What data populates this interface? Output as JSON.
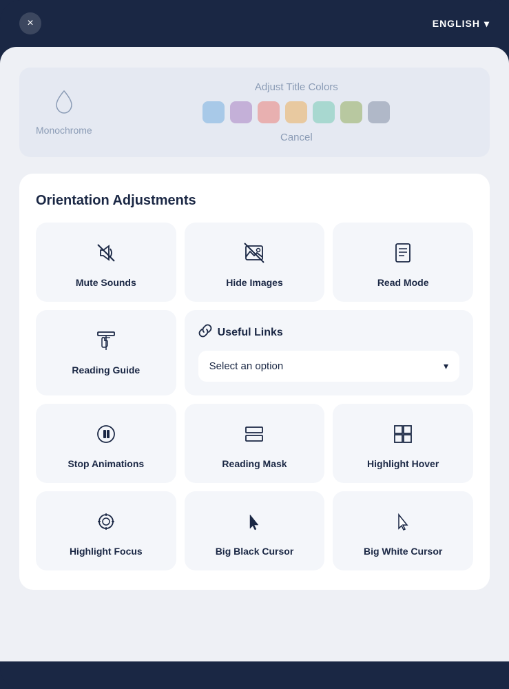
{
  "topBar": {
    "closeLabel": "×",
    "language": "ENGLISH",
    "chevron": "▾"
  },
  "colorSection": {
    "monochromeLabel": "Monochrome",
    "adjustTitle": "Adjust Title Colors",
    "cancelLabel": "Cancel",
    "swatches": [
      {
        "color": "#a8c9e8",
        "name": "blue"
      },
      {
        "color": "#c4b0d8",
        "name": "purple"
      },
      {
        "color": "#e8b0b0",
        "name": "pink"
      },
      {
        "color": "#e8c9a0",
        "name": "orange"
      },
      {
        "color": "#a8d8d0",
        "name": "teal"
      },
      {
        "color": "#b8c8a0",
        "name": "green"
      },
      {
        "color": "#b0b8c8",
        "name": "gray"
      }
    ]
  },
  "orientationSection": {
    "title": "Orientation Adjustments",
    "cards": [
      {
        "id": "mute-sounds",
        "label": "Mute Sounds",
        "icon": "mute"
      },
      {
        "id": "hide-images",
        "label": "Hide Images",
        "icon": "hide-images"
      },
      {
        "id": "read-mode",
        "label": "Read Mode",
        "icon": "read-mode"
      },
      {
        "id": "reading-guide",
        "label": "Reading Guide",
        "icon": "reading-guide"
      },
      {
        "id": "stop-animations",
        "label": "Stop Animations",
        "icon": "stop-anim"
      },
      {
        "id": "reading-mask",
        "label": "Reading Mask",
        "icon": "reading-mask"
      },
      {
        "id": "highlight-hover",
        "label": "Highlight Hover",
        "icon": "highlight-hover"
      },
      {
        "id": "highlight-focus",
        "label": "Highlight Focus",
        "icon": "highlight-focus"
      },
      {
        "id": "big-black-cursor",
        "label": "Big Black Cursor",
        "icon": "big-black"
      },
      {
        "id": "big-white-cursor",
        "label": "Big White Cursor",
        "icon": "big-white"
      }
    ],
    "usefulLinks": {
      "label": "Useful Links",
      "selectPlaceholder": "Select an option",
      "chevron": "▾"
    }
  }
}
